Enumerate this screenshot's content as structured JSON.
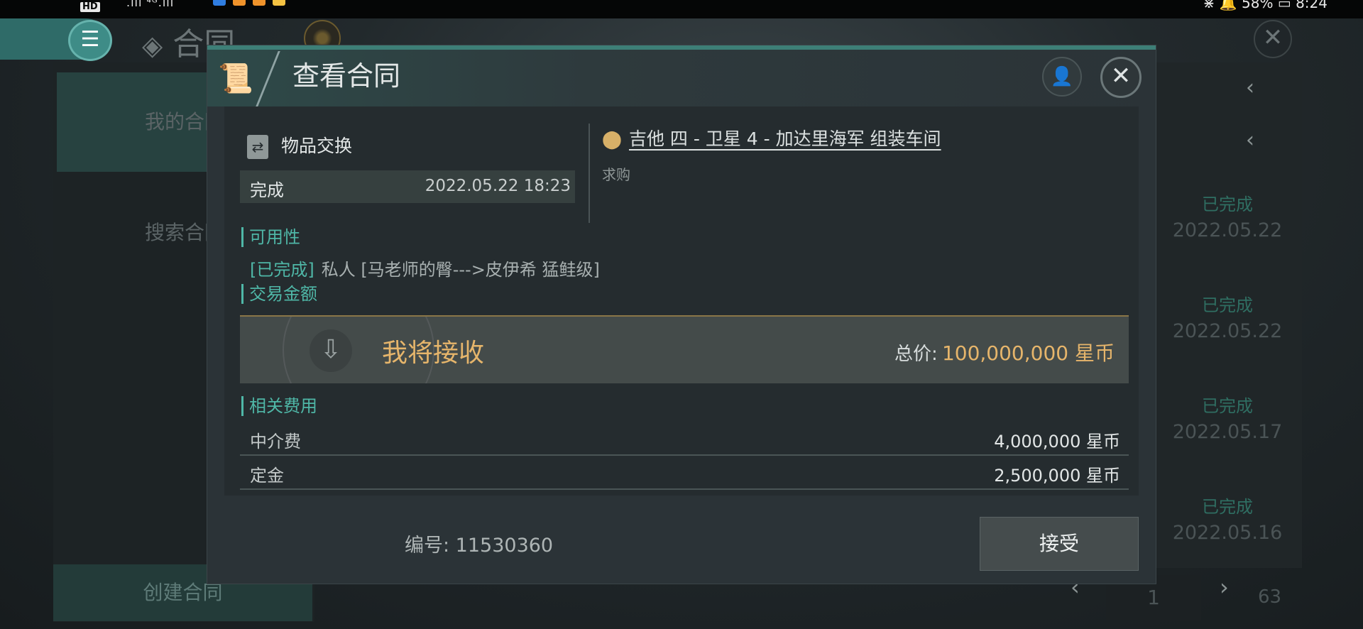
{
  "status_bar": {
    "badge": "HD",
    "signal": ".ıll ⁴ᴳ.ıll",
    "right": "⋇ 🔔 58% ▭ 8:24",
    "dot_colors": [
      "#2f7de1",
      "#f0932b",
      "#f0932b",
      "#f5c242"
    ]
  },
  "background": {
    "title": "合同",
    "sidebar": {
      "my_contracts": "我的合同",
      "search_contracts": "搜索合同",
      "create_contract": "创建合同"
    },
    "rows": [
      {
        "status": "已完成",
        "date": "2022.05.22"
      },
      {
        "status": "已完成",
        "date": "2022.05.22"
      },
      {
        "status": "已完成",
        "date": "2022.05.17"
      },
      {
        "status": "已完成",
        "date": "2022.05.16"
      }
    ],
    "pager": {
      "current_page": "1",
      "total_pages": "63"
    }
  },
  "modal": {
    "title": "查看合同",
    "contract_type": "物品交换",
    "status": "完成",
    "status_datetime": "2022.05.22 18:23",
    "location": "吉他 四 - 卫星 4 - 加达里海军 组装车间",
    "location_note": "求购",
    "availability_label": "可用性",
    "availability_status": "[已完成]",
    "availability_detail": "私人 [马老师的臀--->皮伊希 猛鲑级]",
    "amount_label": "交易金额",
    "receive_label": "我将接收",
    "total_label": "总价:",
    "total_value": "100,000,000 星币",
    "fees_label": "相关费用",
    "fees": [
      {
        "label": "中介费",
        "value": "4,000,000 星币"
      },
      {
        "label": "定金",
        "value": "2,500,000 星币"
      }
    ],
    "contract_no": "编号: 11530360",
    "accept_button": "接受"
  },
  "colors": {
    "accent_teal": "#4fb7a7",
    "gold": "#e6b56b",
    "panel": "#2b3337"
  }
}
